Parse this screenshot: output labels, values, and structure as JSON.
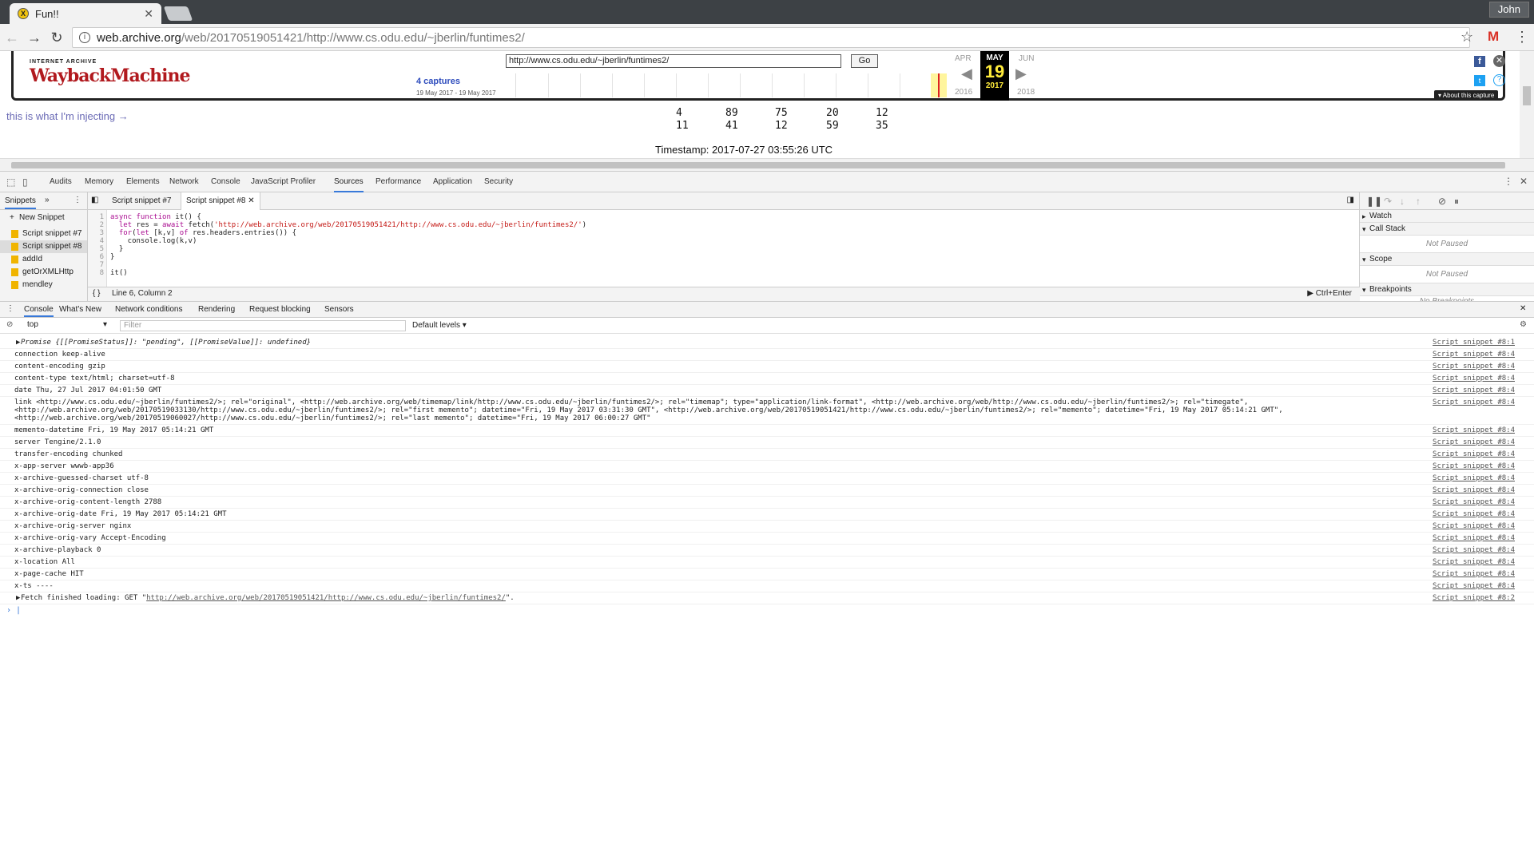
{
  "browser": {
    "tab_title": "Fun!!",
    "user": "John",
    "url_host": "web.archive.org",
    "url_path": "/web/20170519051421/http://www.cs.odu.edu/~jberlin/funtimes2/"
  },
  "wayback": {
    "logo_top": "INTERNET ARCHIVE",
    "logo_main": "WaybackMachine",
    "url_value": "http://www.cs.odu.edu/~jberlin/funtimes2/",
    "go": "Go",
    "captures": "4 captures",
    "range": "19 May 2017 - 19 May 2017",
    "prev_month": "APR",
    "cur_month": "MAY",
    "next_month": "JUN",
    "day": "19",
    "prev_year": "2016",
    "cur_year": "2017",
    "next_year": "2018",
    "about": "▾ About this capture"
  },
  "page": {
    "inject_text": "this is what I'm injecting →",
    "numbers_row1": [
      "4",
      "89",
      "75",
      "20",
      "12"
    ],
    "numbers_row2": [
      "11",
      "41",
      "12",
      "59",
      "35"
    ],
    "timestamp": "Timestamp: 2017-07-27 03:55:26 UTC"
  },
  "devtools": {
    "tabs": [
      "Audits",
      "Memory",
      "Elements",
      "Network",
      "Console",
      "JavaScript Profiler",
      "Sources",
      "Performance",
      "Application",
      "Security"
    ],
    "nav": {
      "header": "Snippets",
      "new_snippet": "New Snippet",
      "items": [
        "Script snippet #7",
        "Script snippet #8",
        "addId",
        "getOrXMLHttp",
        "mendley"
      ]
    },
    "editor_tabs": [
      "Script snippet #7",
      "Script snippet #8"
    ],
    "gutter": "1\n2\n3\n4\n5\n6\n7\n8",
    "status": "Line 6, Column 2",
    "run_hint": "Ctrl+Enter",
    "debug": {
      "watch": "Watch",
      "call_stack": "Call Stack",
      "not_paused": "Not Paused",
      "scope": "Scope",
      "breakpoints": "Breakpoints",
      "no_breakpoints": "No Breakpoints"
    },
    "drawer_tabs": [
      "Console",
      "What's New",
      "Network conditions",
      "Rendering",
      "Request blocking",
      "Sensors"
    ],
    "context": "top",
    "filter_placeholder": "Filter",
    "levels": "Default levels"
  },
  "console": {
    "promise": "Promise {[[PromiseStatus]]: \"pending\", [[PromiseValue]]: undefined}",
    "rows": [
      {
        "text": "connection keep-alive",
        "src": "Script snippet #8:4"
      },
      {
        "text": "content-encoding gzip",
        "src": "Script snippet #8:4"
      },
      {
        "text": "content-type text/html; charset=utf-8",
        "src": "Script snippet #8:4"
      },
      {
        "text": "date Thu, 27 Jul 2017 04:01:50 GMT",
        "src": "Script snippet #8:4"
      },
      {
        "text": "link <http://www.cs.odu.edu/~jberlin/funtimes2/>; rel=\"original\", <http://web.archive.org/web/timemap/link/http://www.cs.odu.edu/~jberlin/funtimes2/>; rel=\"timemap\"; type=\"application/link-format\", <http://web.archive.org/web/http://www.cs.odu.edu/~jberlin/funtimes2/>; rel=\"timegate\", <http://web.archive.org/web/20170519033130/http://www.cs.odu.edu/~jberlin/funtimes2/>; rel=\"first memento\"; datetime=\"Fri, 19 May 2017 03:31:30 GMT\", <http://web.archive.org/web/20170519051421/http://www.cs.odu.edu/~jberlin/funtimes2/>; rel=\"memento\"; datetime=\"Fri, 19 May 2017 05:14:21 GMT\", <http://web.archive.org/web/20170519060027/http://www.cs.odu.edu/~jberlin/funtimes2/>; rel=\"last memento\"; datetime=\"Fri, 19 May 2017 06:00:27 GMT\"",
        "src": "Script snippet #8:4"
      },
      {
        "text": "memento-datetime Fri, 19 May 2017 05:14:21 GMT",
        "src": "Script snippet #8:4"
      },
      {
        "text": "server Tengine/2.1.0",
        "src": "Script snippet #8:4"
      },
      {
        "text": "transfer-encoding chunked",
        "src": "Script snippet #8:4"
      },
      {
        "text": "x-app-server wwwb-app36",
        "src": "Script snippet #8:4"
      },
      {
        "text": "x-archive-guessed-charset utf-8",
        "src": "Script snippet #8:4"
      },
      {
        "text": "x-archive-orig-connection close",
        "src": "Script snippet #8:4"
      },
      {
        "text": "x-archive-orig-content-length 2788",
        "src": "Script snippet #8:4"
      },
      {
        "text": "x-archive-orig-date Fri, 19 May 2017 05:14:21 GMT",
        "src": "Script snippet #8:4"
      },
      {
        "text": "x-archive-orig-server nginx",
        "src": "Script snippet #8:4"
      },
      {
        "text": "x-archive-orig-vary Accept-Encoding",
        "src": "Script snippet #8:4"
      },
      {
        "text": "x-archive-playback 0",
        "src": "Script snippet #8:4"
      },
      {
        "text": "x-location All",
        "src": "Script snippet #8:4"
      },
      {
        "text": "x-page-cache HIT",
        "src": "Script snippet #8:4"
      },
      {
        "text": "x-ts ----",
        "src": "Script snippet #8:4"
      }
    ],
    "promise_src": "Script snippet #8:1",
    "fetch_text_pre": "Fetch finished loading: GET \"",
    "fetch_url": "http://web.archive.org/web/20170519051421/http://www.cs.odu.edu/~jberlin/funtimes2/",
    "fetch_text_post": "\".",
    "fetch_src": "Script snippet #8:2"
  },
  "colors": {
    "accent": "#3879d9",
    "wayback_red": "#b1191e",
    "tab_strip": "#3d4145"
  }
}
